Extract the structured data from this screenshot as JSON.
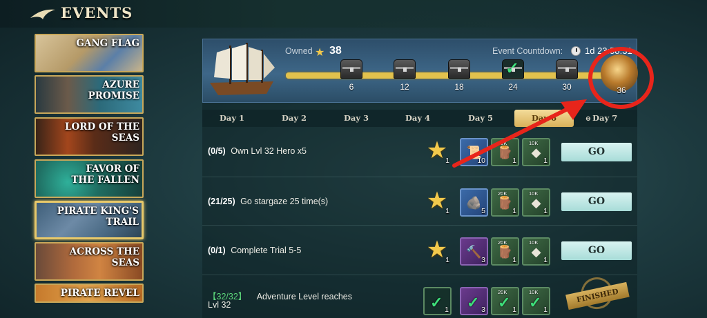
{
  "header": {
    "title": "EVENTS"
  },
  "sidebar": {
    "items": [
      {
        "label": "GANG FLAG"
      },
      {
        "label": "AZURE\nPROMISE"
      },
      {
        "label": "LORD OF THE\nSEAS"
      },
      {
        "label": "FAVOR OF\nTHE FALLEN"
      },
      {
        "label": "PIRATE KING'S\nTRAIL",
        "active": true
      },
      {
        "label": "ACROSS THE\nSEAS"
      },
      {
        "label": "PIRATE REVEL"
      }
    ]
  },
  "progress": {
    "owned_label": "Owned",
    "owned_count": "38",
    "countdown_label": "Event Countdown:",
    "countdown_value": "1d 23:58:31",
    "milestones": [
      {
        "value": "6",
        "claimed": false
      },
      {
        "value": "12",
        "claimed": false
      },
      {
        "value": "18",
        "claimed": false
      },
      {
        "value": "24",
        "claimed": true
      },
      {
        "value": "30",
        "claimed": false
      },
      {
        "value": "36",
        "final": true
      }
    ]
  },
  "tabs": [
    {
      "label": "Day 1"
    },
    {
      "label": "Day 2"
    },
    {
      "label": "Day 3"
    },
    {
      "label": "Day 4"
    },
    {
      "label": "Day 5"
    },
    {
      "label": "Day 6",
      "active": true
    },
    {
      "label": "Day 7",
      "locked": true
    }
  ],
  "tasks": [
    {
      "progress": "(0/5)",
      "description": "Own Lvl 32 Hero x5",
      "star_qty": "1",
      "rewards": [
        {
          "icon": "scroll-icon",
          "color": "blue",
          "tag": "",
          "qty": "10"
        },
        {
          "icon": "wood-icon",
          "color": "green",
          "tag": "20K",
          "qty": "1"
        },
        {
          "icon": "ore-icon",
          "color": "green",
          "tag": "10K",
          "qty": "1"
        }
      ],
      "button": "GO"
    },
    {
      "progress": "(21/25)",
      "description": "Go stargaze 25 time(s)",
      "star_qty": "1",
      "rewards": [
        {
          "icon": "ore-chunk-icon",
          "color": "blue",
          "tag": "",
          "qty": "5"
        },
        {
          "icon": "wood-icon",
          "color": "green",
          "tag": "20K",
          "qty": "1"
        },
        {
          "icon": "ore-icon",
          "color": "green",
          "tag": "10K",
          "qty": "1"
        }
      ],
      "button": "GO"
    },
    {
      "progress": "(0/1)",
      "description": "Complete Trial 5-5",
      "star_qty": "1",
      "rewards": [
        {
          "icon": "hammer-icon",
          "color": "purple",
          "tag": "",
          "qty": "3"
        },
        {
          "icon": "wood-icon",
          "color": "green",
          "tag": "20K",
          "qty": "1"
        },
        {
          "icon": "ore-icon",
          "color": "green",
          "tag": "10K",
          "qty": "1"
        }
      ],
      "button": "GO"
    },
    {
      "progress": "【32/32】",
      "description": "Adventure Level reaches",
      "description2": "Lvl 32",
      "star_qty": "1",
      "rewards": [
        {
          "icon": "hammer-icon",
          "color": "purple",
          "tag": "",
          "qty": "3"
        },
        {
          "icon": "wood-icon",
          "color": "green",
          "tag": "20K",
          "qty": "1"
        },
        {
          "icon": "ore-icon",
          "color": "green",
          "tag": "10K",
          "qty": "1"
        }
      ],
      "status": "FINISHED"
    }
  ],
  "colors": {
    "accent_gold": "#e2c24d",
    "highlight_red": "#e8251b",
    "go_button": "#bfe8e4"
  }
}
